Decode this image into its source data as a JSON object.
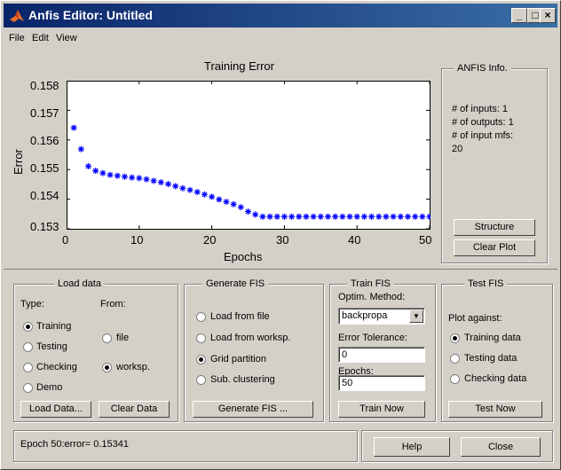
{
  "window": {
    "title": "Anfis Editor: Untitled",
    "minimize": "_",
    "maximize": "□",
    "close": "×"
  },
  "menu": [
    "File",
    "Edit",
    "View"
  ],
  "chart_data": {
    "type": "scatter",
    "title": "Training Error",
    "xlabel": "Epochs",
    "ylabel": "Error",
    "xlim": [
      0,
      50
    ],
    "ylim": [
      0.153,
      0.158
    ],
    "xticks": [
      "0",
      "10",
      "20",
      "30",
      "40",
      "50"
    ],
    "yticks": [
      "0.158",
      "0.157",
      "0.156",
      "0.155",
      "0.154",
      "0.153"
    ],
    "marker": "*",
    "color": "#0000ff",
    "x": [
      1,
      2,
      3,
      4,
      5,
      6,
      7,
      8,
      9,
      10,
      11,
      12,
      13,
      14,
      15,
      16,
      17,
      18,
      19,
      20,
      21,
      22,
      23,
      24,
      25,
      26,
      27,
      28,
      29,
      30,
      31,
      32,
      33,
      34,
      35,
      36,
      37,
      38,
      39,
      40,
      41,
      42,
      43,
      44,
      45,
      46,
      47,
      48,
      49,
      50
    ],
    "y": [
      0.15641,
      0.15569,
      0.15511,
      0.15496,
      0.15488,
      0.15482,
      0.15479,
      0.15476,
      0.15473,
      0.15471,
      0.15467,
      0.15462,
      0.15457,
      0.15451,
      0.15444,
      0.15437,
      0.15431,
      0.15424,
      0.15416,
      0.15408,
      0.15399,
      0.15391,
      0.15383,
      0.15373,
      0.15358,
      0.15348,
      0.15341,
      0.15341,
      0.15341,
      0.15341,
      0.15341,
      0.15341,
      0.15341,
      0.15341,
      0.15341,
      0.15341,
      0.15341,
      0.15341,
      0.15341,
      0.15341,
      0.15341,
      0.15341,
      0.15341,
      0.15341,
      0.15341,
      0.15341,
      0.15341,
      0.15341,
      0.15341,
      0.15341
    ]
  },
  "anfis_info": {
    "title": "ANFIS Info.",
    "lines": [
      "# of inputs: 1",
      "# of outputs: 1",
      "# of input mfs:",
      "20"
    ],
    "structure_button": "Structure",
    "clear_plot_button": "Clear Plot"
  },
  "load_data": {
    "title": "Load data",
    "type_label": "Type:",
    "from_label": "From:",
    "types": [
      "Training",
      "Testing",
      "Checking",
      "Demo"
    ],
    "from": [
      "file",
      "worksp."
    ],
    "load_button": "Load Data...",
    "clear_button": "Clear Data"
  },
  "generate_fis": {
    "title": "Generate FIS",
    "options": [
      "Load from file",
      "Load from worksp.",
      "Grid partition",
      "Sub. clustering"
    ],
    "button": "Generate FIS ..."
  },
  "train_fis": {
    "title": "Train FIS",
    "optim_label": "Optim. Method:",
    "optim_value": "backpropa",
    "tolerance_label": "Error Tolerance:",
    "tolerance_value": "0",
    "epochs_label": "Epochs:",
    "epochs_value": "50",
    "button": "Train Now"
  },
  "test_fis": {
    "title": "Test FIS",
    "plot_against": "Plot against:",
    "options": [
      "Training data",
      "Testing data",
      "Checking data"
    ],
    "button": "Test Now"
  },
  "status": {
    "text": "Epoch 50:error= 0.15341"
  },
  "bottom": {
    "help": "Help",
    "close": "Close"
  }
}
